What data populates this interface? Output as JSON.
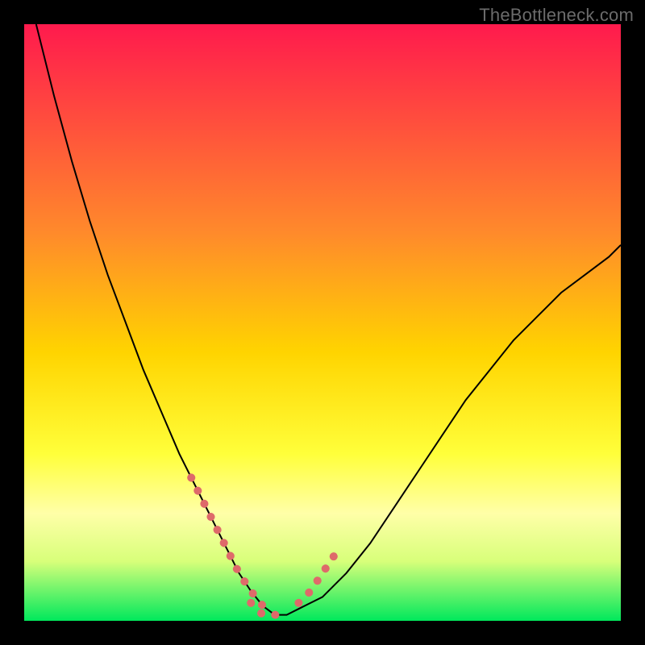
{
  "watermark": "TheBottleneck.com",
  "chart_data": {
    "type": "line",
    "title": "",
    "xlabel": "",
    "ylabel": "",
    "xlim": [
      0,
      100
    ],
    "ylim": [
      0,
      100
    ],
    "background_gradient": {
      "stops": [
        {
          "offset": 0,
          "color": "#ff1a4d"
        },
        {
          "offset": 35,
          "color": "#ff8a2b"
        },
        {
          "offset": 55,
          "color": "#ffd400"
        },
        {
          "offset": 72,
          "color": "#ffff3a"
        },
        {
          "offset": 82,
          "color": "#ffffa8"
        },
        {
          "offset": 90,
          "color": "#d8ff7a"
        },
        {
          "offset": 100,
          "color": "#00e85c"
        }
      ]
    },
    "series": [
      {
        "name": "curve",
        "stroke": "#000000",
        "stroke_width": 2,
        "x": [
          2,
          5,
          8,
          11,
          14,
          17,
          20,
          23,
          26,
          29,
          32,
          34,
          36,
          38,
          40,
          42,
          44,
          46,
          50,
          54,
          58,
          62,
          66,
          70,
          74,
          78,
          82,
          86,
          90,
          94,
          98,
          100
        ],
        "y": [
          0,
          12,
          23,
          33,
          42,
          50,
          58,
          65,
          72,
          78,
          84,
          88,
          92,
          95,
          97.5,
          99,
          99,
          98,
          96,
          92,
          87,
          81,
          75,
          69,
          63,
          58,
          53,
          49,
          45,
          42,
          39,
          37
        ]
      },
      {
        "name": "highlight-left",
        "stroke": "#de6a6a",
        "stroke_width": 10,
        "dash": "0.1 18",
        "linecap": "round",
        "x": [
          28,
          30,
          32,
          34,
          36,
          38,
          40
        ],
        "y": [
          76,
          80,
          84,
          88,
          92,
          95,
          97.5
        ]
      },
      {
        "name": "highlight-bottom",
        "stroke": "#de6a6a",
        "stroke_width": 10,
        "dash": "0.1 18",
        "linecap": "round",
        "x": [
          38,
          40,
          42,
          44
        ],
        "y": [
          97,
          99,
          99,
          99
        ]
      },
      {
        "name": "highlight-right",
        "stroke": "#de6a6a",
        "stroke_width": 10,
        "dash": "0.1 18",
        "linecap": "round",
        "x": [
          46,
          48,
          50,
          52
        ],
        "y": [
          97,
          95,
          92,
          89
        ]
      }
    ]
  }
}
